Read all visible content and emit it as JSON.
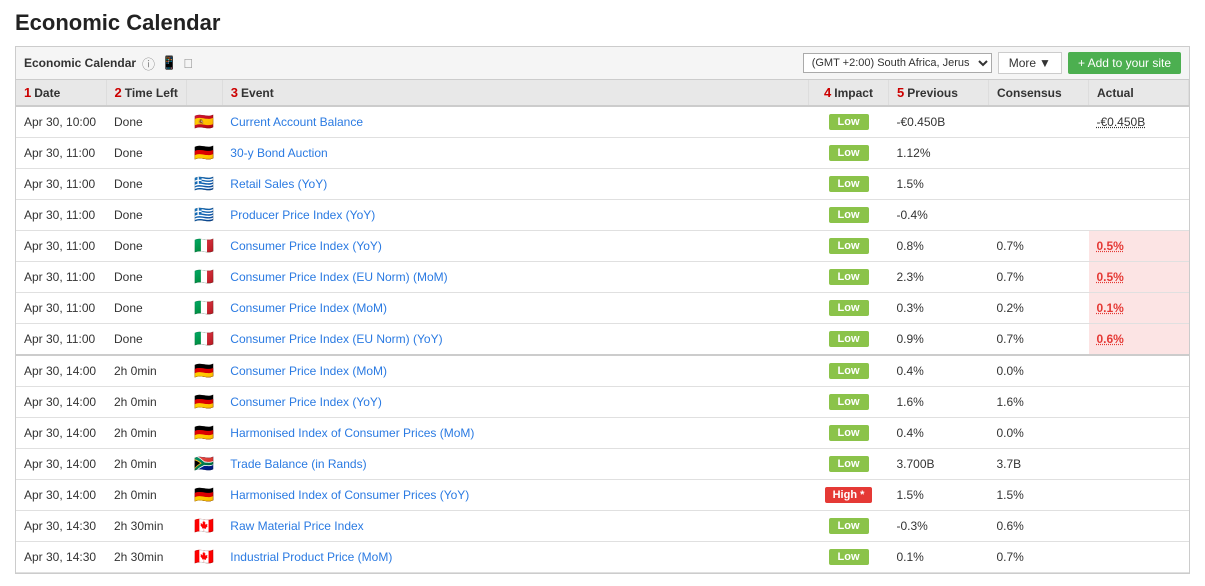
{
  "page": {
    "title": "Economic Calendar"
  },
  "toolbar": {
    "label": "Economic Calendar",
    "help_icon": "?",
    "android_icon": "android",
    "apple_icon": "apple",
    "timezone": "(GMT +2:00) South Africa, Jerus",
    "more_label": "More",
    "add_site_label": "+ Add to your site"
  },
  "table": {
    "columns": [
      {
        "num": "1",
        "label": "Date"
      },
      {
        "num": "2",
        "label": "Time Left"
      },
      {
        "num": "3",
        "label": "Event"
      },
      {
        "num": "4",
        "label": "Impact"
      },
      {
        "num": "5",
        "label": "Previous"
      },
      {
        "num": "",
        "label": "Consensus"
      },
      {
        "num": "",
        "label": "Actual"
      }
    ],
    "rows": [
      {
        "date": "Apr 30, 10:00",
        "time_left": "Done",
        "flag": "🇪🇸",
        "event": "Current Account Balance",
        "impact": "Low",
        "impact_type": "low",
        "previous": "-€0.450B",
        "consensus": "",
        "actual": "-€0.450B",
        "actual_class": "neutral",
        "highlight": false,
        "group_sep": false
      },
      {
        "date": "Apr 30, 11:00",
        "time_left": "Done",
        "flag": "🇩🇪",
        "event": "30-y Bond Auction",
        "impact": "Low",
        "impact_type": "low",
        "previous": "1.12%",
        "consensus": "",
        "actual": "",
        "actual_class": "",
        "highlight": false,
        "group_sep": false
      },
      {
        "date": "Apr 30, 11:00",
        "time_left": "Done",
        "flag": "🇬🇷",
        "event": "Retail Sales (YoY)",
        "impact": "Low",
        "impact_type": "low",
        "previous": "1.5%",
        "consensus": "",
        "actual": "",
        "actual_class": "",
        "highlight": false,
        "group_sep": false
      },
      {
        "date": "Apr 30, 11:00",
        "time_left": "Done",
        "flag": "🇬🇷",
        "event": "Producer Price Index (YoY)",
        "impact": "Low",
        "impact_type": "low",
        "previous": "-0.4%",
        "consensus": "",
        "actual": "",
        "actual_class": "",
        "highlight": false,
        "group_sep": false
      },
      {
        "date": "Apr 30, 11:00",
        "time_left": "Done",
        "flag": "🇮🇹",
        "event": "Consumer Price Index (YoY)",
        "impact": "Low",
        "impact_type": "low",
        "previous": "0.8%",
        "consensus": "0.7%",
        "actual": "0.5%",
        "actual_class": "negative",
        "highlight": true,
        "group_sep": false
      },
      {
        "date": "Apr 30, 11:00",
        "time_left": "Done",
        "flag": "🇮🇹",
        "event": "Consumer Price Index (EU Norm) (MoM)",
        "impact": "Low",
        "impact_type": "low",
        "previous": "2.3%",
        "consensus": "0.7%",
        "actual": "0.5%",
        "actual_class": "negative",
        "highlight": true,
        "group_sep": false
      },
      {
        "date": "Apr 30, 11:00",
        "time_left": "Done",
        "flag": "🇮🇹",
        "event": "Consumer Price Index (MoM)",
        "impact": "Low",
        "impact_type": "low",
        "previous": "0.3%",
        "consensus": "0.2%",
        "actual": "0.1%",
        "actual_class": "negative",
        "highlight": true,
        "group_sep": false
      },
      {
        "date": "Apr 30, 11:00",
        "time_left": "Done",
        "flag": "🇮🇹",
        "event": "Consumer Price Index (EU Norm) (YoY)",
        "impact": "Low",
        "impact_type": "low",
        "previous": "0.9%",
        "consensus": "0.7%",
        "actual": "0.6%",
        "actual_class": "negative",
        "highlight": true,
        "group_sep": false
      },
      {
        "date": "Apr 30, 14:00",
        "time_left": "2h 0min",
        "flag": "🇩🇪",
        "event": "Consumer Price Index (MoM)",
        "impact": "Low",
        "impact_type": "low",
        "previous": "0.4%",
        "consensus": "0.0%",
        "actual": "",
        "actual_class": "",
        "highlight": false,
        "group_sep": true
      },
      {
        "date": "Apr 30, 14:00",
        "time_left": "2h 0min",
        "flag": "🇩🇪",
        "event": "Consumer Price Index (YoY)",
        "impact": "Low",
        "impact_type": "low",
        "previous": "1.6%",
        "consensus": "1.6%",
        "actual": "",
        "actual_class": "",
        "highlight": false,
        "group_sep": false
      },
      {
        "date": "Apr 30, 14:00",
        "time_left": "2h 0min",
        "flag": "🇩🇪",
        "event": "Harmonised Index of Consumer Prices (MoM)",
        "impact": "Low",
        "impact_type": "low",
        "previous": "0.4%",
        "consensus": "0.0%",
        "actual": "",
        "actual_class": "",
        "highlight": false,
        "group_sep": false
      },
      {
        "date": "Apr 30, 14:00",
        "time_left": "2h 0min",
        "flag": "🇿🇦",
        "event": "Trade Balance (in Rands)",
        "impact": "Low",
        "impact_type": "low",
        "previous": "3.700B",
        "consensus": "3.7B",
        "actual": "",
        "actual_class": "",
        "highlight": false,
        "group_sep": false
      },
      {
        "date": "Apr 30, 14:00",
        "time_left": "2h 0min",
        "flag": "🇩🇪",
        "event": "Harmonised Index of Consumer Prices (YoY)",
        "impact": "High *",
        "impact_type": "high",
        "previous": "1.5%",
        "consensus": "1.5%",
        "actual": "",
        "actual_class": "",
        "highlight": false,
        "group_sep": false
      },
      {
        "date": "Apr 30, 14:30",
        "time_left": "2h 30min",
        "flag": "🇨🇦",
        "event": "Raw Material Price Index",
        "impact": "Low",
        "impact_type": "low",
        "previous": "-0.3%",
        "consensus": "0.6%",
        "actual": "",
        "actual_class": "",
        "highlight": false,
        "group_sep": false
      },
      {
        "date": "Apr 30, 14:30",
        "time_left": "2h 30min",
        "flag": "🇨🇦",
        "event": "Industrial Product Price (MoM)",
        "impact": "Low",
        "impact_type": "low",
        "previous": "0.1%",
        "consensus": "0.7%",
        "actual": "",
        "actual_class": "",
        "highlight": false,
        "group_sep": false
      }
    ]
  }
}
